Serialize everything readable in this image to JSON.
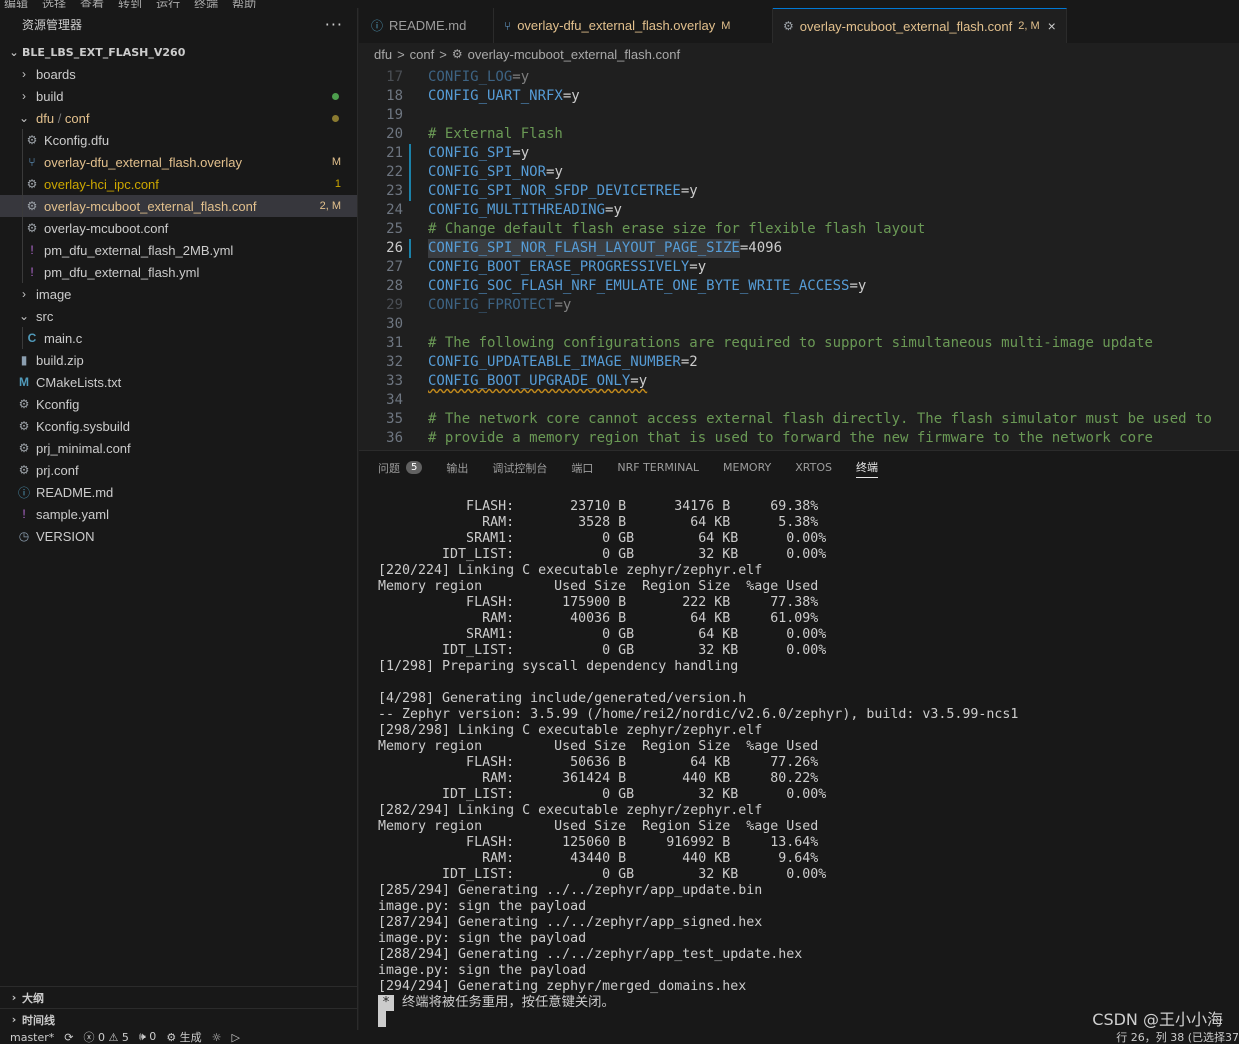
{
  "menubar": [
    "编辑",
    "选择",
    "查看",
    "转到",
    "运行",
    "终端",
    "帮助"
  ],
  "sidebar": {
    "title": "资源管理器",
    "more": "···",
    "root": "BLE_LBS_EXT_FLASH_V260",
    "items": [
      {
        "label": "boards",
        "icon": "chevron-right-icon",
        "indent": 1
      },
      {
        "label": "build",
        "icon": "chevron-right-icon",
        "indent": 1,
        "dot": "#4d9e4d"
      },
      {
        "label_a": "dfu",
        "label_b": "conf",
        "icon": "chevron-down-icon",
        "indent": 1,
        "dot": "#8a7a30"
      },
      {
        "label": "Kconfig.dfu",
        "icon": "gear-icon",
        "indent": 2
      },
      {
        "label": "overlay-dfu_external_flash.overlay",
        "icon": "devicetree-icon",
        "indent": 2,
        "badge": "M"
      },
      {
        "label": "overlay-hci_ipc.conf",
        "icon": "gear-icon",
        "indent": 2,
        "badge": "1"
      },
      {
        "label": "overlay-mcuboot_external_flash.conf",
        "icon": "gear-icon",
        "indent": 2,
        "badge": "2, M"
      },
      {
        "label": "overlay-mcuboot.conf",
        "icon": "gear-icon",
        "indent": 2
      },
      {
        "label": "pm_dfu_external_flash_2MB.yml",
        "icon": "yaml-icon",
        "indent": 2
      },
      {
        "label": "pm_dfu_external_flash.yml",
        "icon": "yaml-icon",
        "indent": 2
      },
      {
        "label": "image",
        "icon": "chevron-right-icon",
        "indent": 1
      },
      {
        "label": "src",
        "icon": "chevron-down-icon",
        "indent": 1
      },
      {
        "label": "main.c",
        "icon": "c-file-icon",
        "indent": 2
      },
      {
        "label": "build.zip",
        "icon": "zip-icon",
        "indent": 1
      },
      {
        "label": "CMakeLists.txt",
        "icon": "cmake-icon",
        "indent": 1
      },
      {
        "label": "Kconfig",
        "icon": "gear-icon",
        "indent": 1
      },
      {
        "label": "Kconfig.sysbuild",
        "icon": "gear-icon",
        "indent": 1
      },
      {
        "label": "prj_minimal.conf",
        "icon": "gear-icon",
        "indent": 1
      },
      {
        "label": "prj.conf",
        "icon": "gear-icon",
        "indent": 1
      },
      {
        "label": "README.md",
        "icon": "info-icon",
        "indent": 1
      },
      {
        "label": "sample.yaml",
        "icon": "yaml-icon",
        "indent": 1
      },
      {
        "label": "VERSION",
        "icon": "version-icon",
        "indent": 1
      }
    ],
    "sections": [
      "大纲",
      "时间线"
    ]
  },
  "tabs": [
    {
      "label": "README.md",
      "icon": "info-icon",
      "mod": ""
    },
    {
      "label": "overlay-dfu_external_flash.overlay",
      "icon": "devicetree-icon",
      "mod": "M"
    },
    {
      "label": "overlay-mcuboot_external_flash.conf",
      "icon": "gear-icon",
      "mod": "2, M",
      "close": "×"
    }
  ],
  "breadcrumb": {
    "a": "dfu",
    "b": "conf",
    "sep": ">",
    "file": "overlay-mcuboot_external_flash.conf"
  },
  "code": [
    {
      "n": "17",
      "segs": [
        [
          "kw",
          "CONFIG_LOG"
        ],
        [
          "ctext",
          "=y"
        ]
      ],
      "dim": true
    },
    {
      "n": "18",
      "segs": [
        [
          "kw",
          "CONFIG_UART_NRFX"
        ],
        [
          "ctext",
          "=y"
        ]
      ]
    },
    {
      "n": "19",
      "segs": []
    },
    {
      "n": "20",
      "segs": [
        [
          "cm",
          "# External Flash"
        ]
      ]
    },
    {
      "n": "21",
      "segs": [
        [
          "kw",
          "CONFIG_SPI"
        ],
        [
          "ctext",
          "=y"
        ]
      ],
      "mod": true
    },
    {
      "n": "22",
      "segs": [
        [
          "kw",
          "CONFIG_SPI_NOR"
        ],
        [
          "ctext",
          "=y"
        ]
      ],
      "mod": true
    },
    {
      "n": "23",
      "segs": [
        [
          "kw",
          "CONFIG_SPI_NOR_SFDP_DEVICETREE"
        ],
        [
          "ctext",
          "=y"
        ]
      ],
      "mod": true
    },
    {
      "n": "24",
      "segs": [
        [
          "kw",
          "CONFIG_MULTITHREADING"
        ],
        [
          "ctext",
          "=y"
        ]
      ]
    },
    {
      "n": "25",
      "segs": [
        [
          "cm",
          "# Change default flash erase size for flexible flash layout"
        ]
      ]
    },
    {
      "n": "26",
      "segs": [
        [
          "kw hl",
          "CONFIG_SPI_NOR_FLASH_LAYOUT_PAGE_SIZE"
        ],
        [
          "ctext",
          "=4096"
        ]
      ],
      "mod": true,
      "current": true
    },
    {
      "n": "27",
      "segs": [
        [
          "kw",
          "CONFIG_BOOT_ERASE_PROGRESSIVELY"
        ],
        [
          "ctext",
          "=y"
        ]
      ]
    },
    {
      "n": "28",
      "segs": [
        [
          "kw",
          "CONFIG_SOC_FLASH_NRF_EMULATE_ONE_BYTE_WRITE_ACCESS"
        ],
        [
          "ctext",
          "=y"
        ]
      ]
    },
    {
      "n": "29",
      "segs": [
        [
          "kw",
          "CONFIG_FPROTECT"
        ],
        [
          "ctext",
          "=y"
        ]
      ],
      "dim": true
    },
    {
      "n": "30",
      "segs": []
    },
    {
      "n": "31",
      "segs": [
        [
          "cm",
          "# The following configurations are required to support simultaneous multi-image update"
        ]
      ]
    },
    {
      "n": "32",
      "segs": [
        [
          "kw",
          "CONFIG_UPDATEABLE_IMAGE_NUMBER"
        ],
        [
          "ctext",
          "=2"
        ]
      ]
    },
    {
      "n": "33",
      "segs": [
        [
          "kw squig",
          "CONFIG_BOOT_UPGRADE_ONLY"
        ],
        [
          "ctext squig",
          "=y"
        ]
      ]
    },
    {
      "n": "34",
      "segs": []
    },
    {
      "n": "35",
      "segs": [
        [
          "cm",
          "# The network core cannot access external flash directly. The flash simulator must be used to"
        ]
      ]
    },
    {
      "n": "36",
      "segs": [
        [
          "cm",
          "# provide a memory region that is used to forward the new firmware to the network core"
        ]
      ]
    }
  ],
  "panel_tabs": [
    {
      "label": "问题",
      "badge": "5"
    },
    {
      "label": "输出"
    },
    {
      "label": "调试控制台"
    },
    {
      "label": "端口"
    },
    {
      "label": "NRF TERMINAL"
    },
    {
      "label": "MEMORY"
    },
    {
      "label": "XRTOS"
    },
    {
      "label": "终端",
      "active": true
    }
  ],
  "terminal": [
    "           FLASH:       23710 B      34176 B     69.38%",
    "             RAM:        3528 B        64 KB      5.38%",
    "           SRAM1:           0 GB        64 KB      0.00%",
    "        IDT_LIST:           0 GB        32 KB      0.00%",
    "[220/224] Linking C executable zephyr/zephyr.elf",
    "Memory region         Used Size  Region Size  %age Used",
    "           FLASH:      175900 B       222 KB     77.38%",
    "             RAM:       40036 B        64 KB     61.09%",
    "           SRAM1:           0 GB        64 KB      0.00%",
    "        IDT_LIST:           0 GB        32 KB      0.00%",
    "[1/298] Preparing syscall dependency handling",
    "",
    "[4/298] Generating include/generated/version.h",
    "-- Zephyr version: 3.5.99 (/home/rei2/nordic/v2.6.0/zephyr), build: v3.5.99-ncs1",
    "[298/298] Linking C executable zephyr/zephyr.elf",
    "Memory region         Used Size  Region Size  %age Used",
    "           FLASH:       50636 B        64 KB     77.26%",
    "             RAM:      361424 B       440 KB     80.22%",
    "        IDT_LIST:           0 GB        32 KB      0.00%",
    "[282/294] Linking C executable zephyr/zephyr.elf",
    "Memory region         Used Size  Region Size  %age Used",
    "           FLASH:      125060 B     916992 B     13.64%",
    "             RAM:       43440 B       440 KB      9.64%",
    "        IDT_LIST:           0 GB        32 KB      0.00%",
    "[285/294] Generating ../../zephyr/app_update.bin",
    "image.py: sign the payload",
    "[287/294] Generating ../../zephyr/app_signed.hex",
    "image.py: sign the payload",
    "[288/294] Generating ../../zephyr/app_test_update.hex",
    "image.py: sign the payload",
    "[294/294] Generating zephyr/merged_domains.hex"
  ],
  "terminal_prompt": {
    "star": "*",
    "text": " 终端将被任务重用，按任意键关闭。"
  },
  "watermark": "CSDN @王小小海",
  "statusbar": {
    "branch": "master*",
    "sync": "⟳",
    "problems": "ⓧ 0 ⚠ 5",
    "ports": "🕪 0",
    "build": "⚙ 生成",
    "debug": "☼",
    "run": "▷",
    "position": "行 26，列 38 (已选择37"
  },
  "colors": {
    "modified": "#e2c08d",
    "error_badge": "#cca700",
    "keyword": "#569cd6",
    "comment": "#6a9955"
  }
}
